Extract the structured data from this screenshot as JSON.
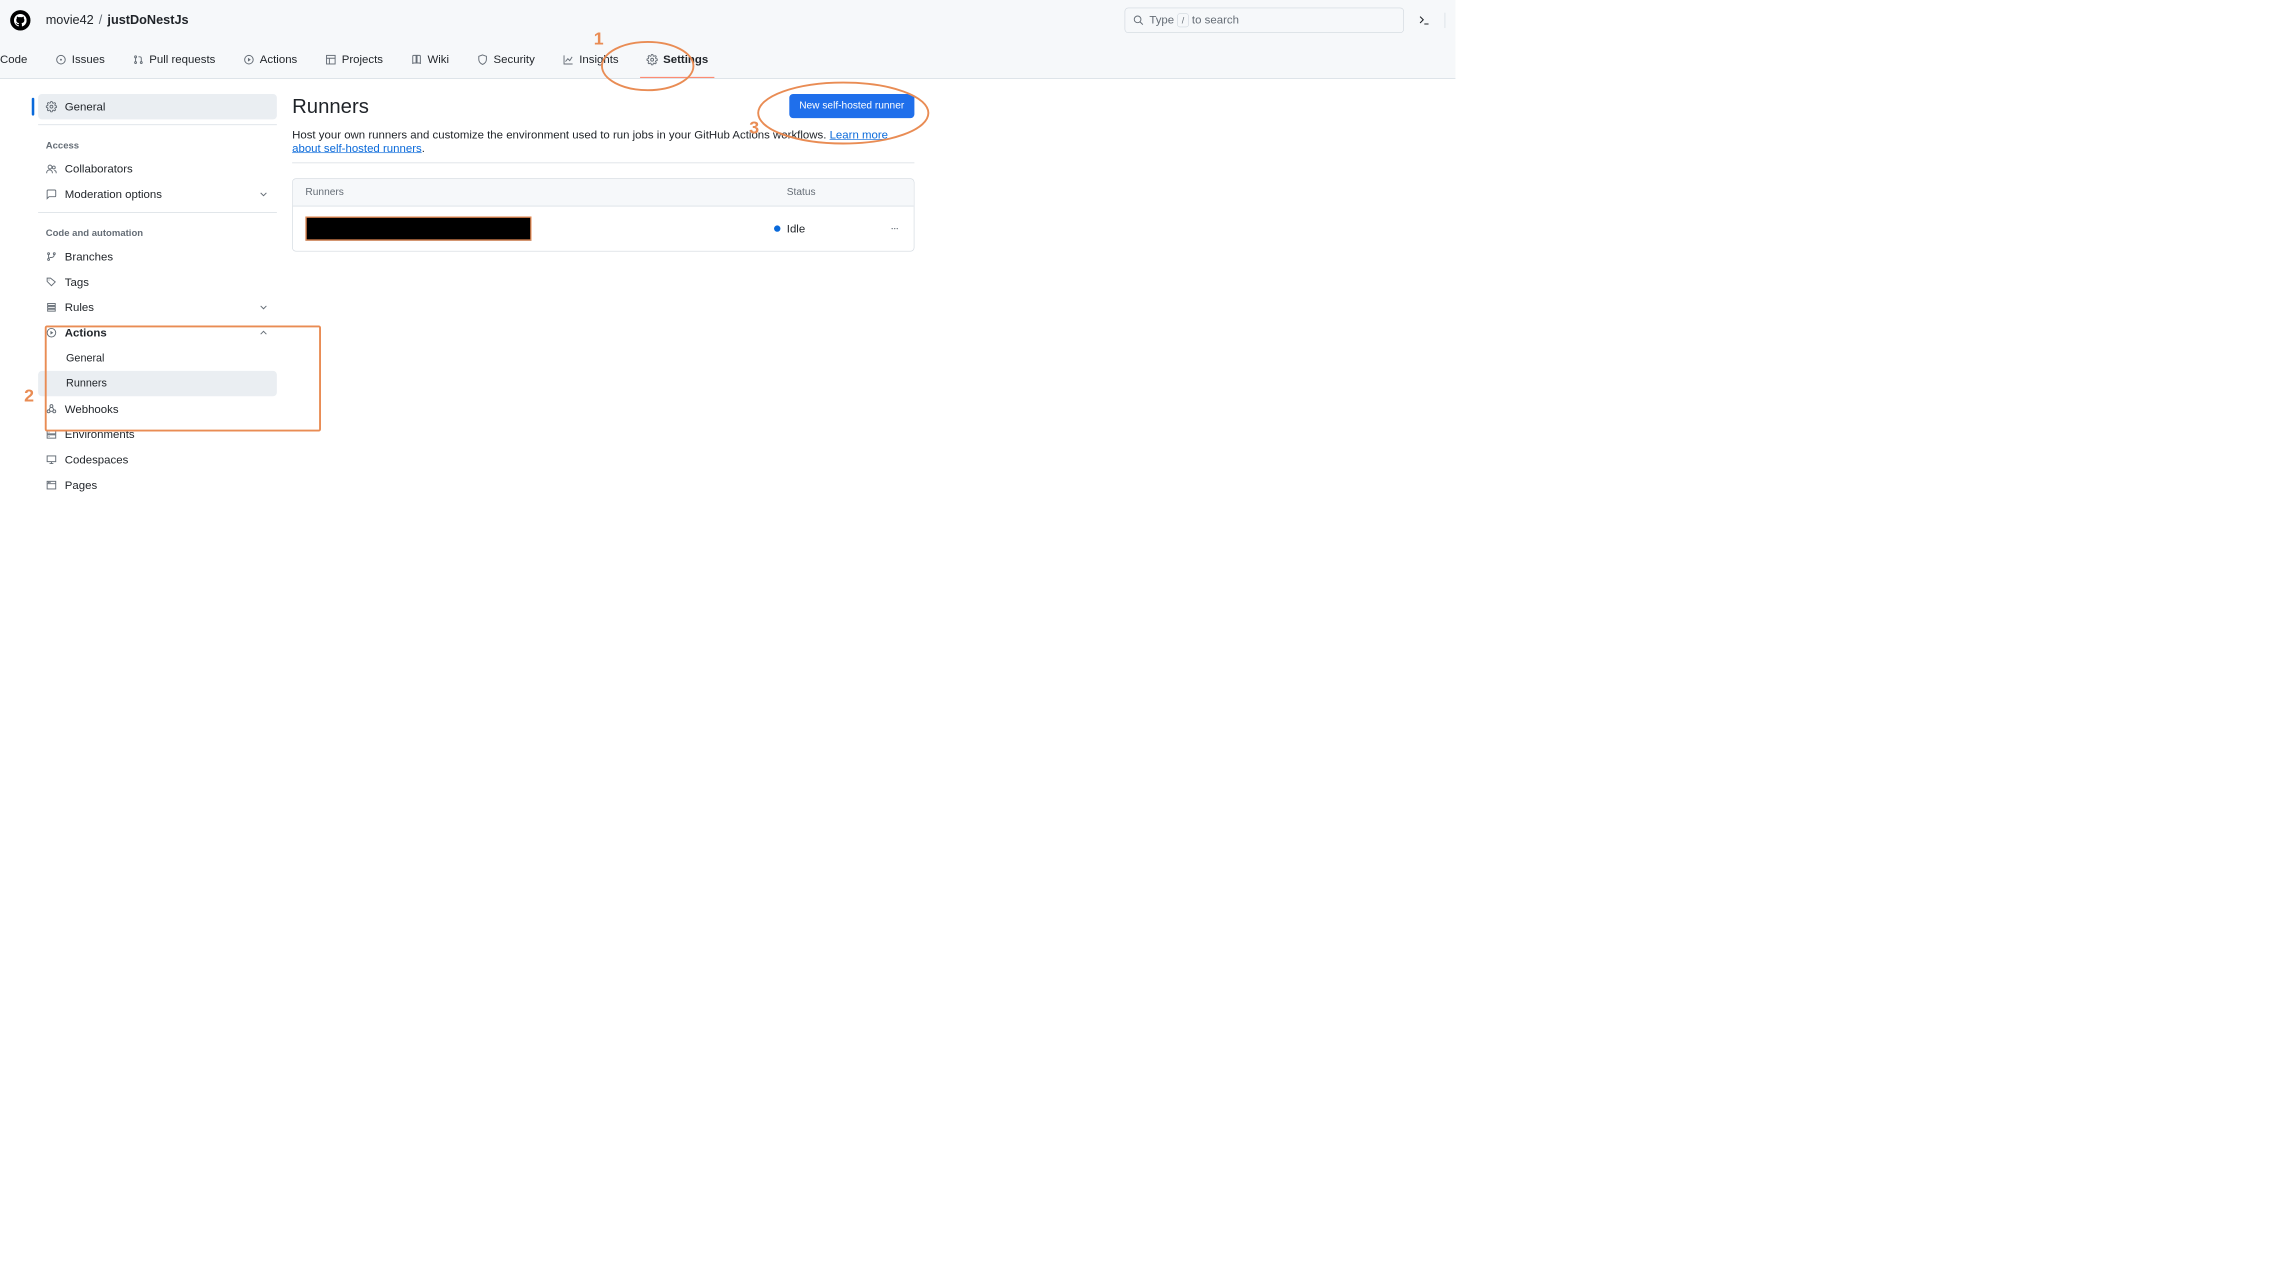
{
  "breadcrumb": {
    "owner": "movie42",
    "sep": "/",
    "repo": "justDoNestJs"
  },
  "search": {
    "prefix": "Type",
    "key": "/",
    "suffix": "to search"
  },
  "tabs": {
    "code": "Code",
    "issues": "Issues",
    "pr": "Pull requests",
    "actions": "Actions",
    "projects": "Projects",
    "wiki": "Wiki",
    "security": "Security",
    "insights": "Insights",
    "settings": "Settings"
  },
  "sidebar": {
    "general": "General",
    "access_header": "Access",
    "collaborators": "Collaborators",
    "moderation": "Moderation options",
    "code_header": "Code and automation",
    "branches": "Branches",
    "tags": "Tags",
    "rules": "Rules",
    "actions": "Actions",
    "actions_sub": {
      "general": "General",
      "runners": "Runners"
    },
    "webhooks": "Webhooks",
    "environments": "Environments",
    "codespaces": "Codespaces",
    "pages": "Pages"
  },
  "main": {
    "title": "Runners",
    "new_runner_btn": "New self-hosted runner",
    "desc_text": "Host your own runners and customize the environment used to run jobs in your GitHub Actions workflows. ",
    "desc_link": "Learn more about self-hosted runners",
    "desc_period": ".",
    "table": {
      "header_name": "Runners",
      "header_status": "Status",
      "rows": [
        {
          "name_redacted": true,
          "status": "Idle"
        }
      ]
    }
  },
  "annotations": {
    "n1": "1",
    "n2": "2",
    "n3": "3"
  }
}
